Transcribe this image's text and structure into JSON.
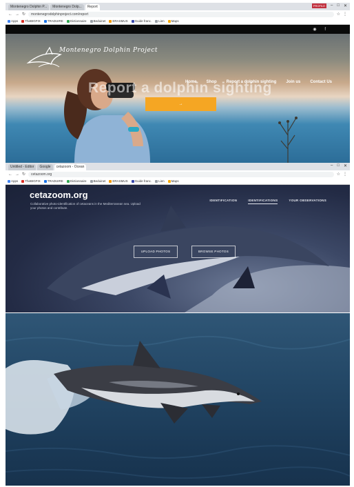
{
  "browser1": {
    "tabs": [
      "Montenegro Dolphin P...",
      "Montenegro Dolp...",
      "Report"
    ],
    "url": "montenegrodolphinproject.com/report",
    "bookmarks": [
      "Apps",
      "TheBIGFIX",
      "TRADUIRE",
      "Dictionnaire",
      "Beduinet",
      "ERASMUS",
      "Guide franc.",
      "Lien",
      "Maps"
    ],
    "window_badge": "PROFILE"
  },
  "site1": {
    "logo_text": "Montenegro Dolphin Project",
    "nav": [
      "Home",
      "Shop",
      "Report a dolphin sighting",
      "Join us",
      "Contact Us"
    ],
    "headline": "Report a dolphin sighting",
    "cta_label": "→",
    "accent": "#f5a623"
  },
  "browser2": {
    "tabs": [
      "Untitled - Editor",
      "Google",
      "cetazoom - Ocean"
    ],
    "url": "cetazoom.org",
    "bookmarks": [
      "Apps",
      "TheBIGFIX",
      "TRADUIRE",
      "Dictionnaire",
      "Beduinet",
      "ERASMUS",
      "Guide franc.",
      "Lien",
      "Maps"
    ]
  },
  "site2": {
    "brand": "cetazoom.org",
    "tagline": "Collaborative photo-identification of cetaceans in the Mediterranean sea. Upload your photos and contribute.",
    "nav": [
      "IDENTIFICATION",
      "IDENTIFICATIONS",
      "YOUR OBSERVATIONS"
    ],
    "buttons": [
      "UPLOAD PHOTOS",
      "BROWSE PHOTOS"
    ]
  }
}
